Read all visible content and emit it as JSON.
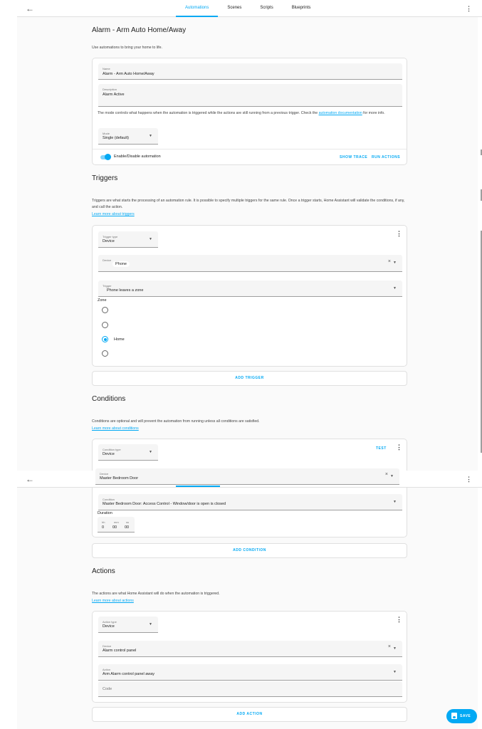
{
  "nav": {
    "tabs": [
      "Automations",
      "Scenes",
      "Scripts",
      "Blueprints"
    ],
    "active_tab": "Automations"
  },
  "page": {
    "title": "Alarm - Arm Auto Home/Away",
    "intro": "Use automations to bring your home to life."
  },
  "details": {
    "name_label": "Name",
    "name_value": "Alarm - Arm Auto Home/Away",
    "description_label": "Description",
    "description_value": "Alarm Active",
    "mode_text": "The mode controls what happens when the automation is triggered while the actions are still running from a previous trigger. Check the",
    "mode_link": "automation documentation",
    "mode_text_end": "for more info.",
    "mode_label": "Mode",
    "mode_value": "Single (default)",
    "toggle_label": "Enable/Disable automation",
    "show_trace": "SHOW TRACE",
    "run_actions": "RUN ACTIONS"
  },
  "triggers": {
    "heading": "Triggers",
    "description": "Triggers are what starts the processing of an automation rule. It is possible to specify multiple triggers for the same rule. Once a trigger starts, Home Assistant will validate the conditions, if any, and call the action.",
    "learn_more": "Learn more about triggers",
    "type_label": "Trigger type",
    "type_value": "Device",
    "device_label": "Device",
    "device_value": "Phone",
    "trigger_label": "Trigger",
    "trigger_value": "Phone leaves a zone",
    "zone_label": "Zone",
    "zone_options": [
      "",
      "",
      "Home",
      ""
    ],
    "zone_selected_index": 2,
    "add_button": "ADD TRIGGER"
  },
  "conditions": {
    "heading": "Conditions",
    "description": "Conditions are optional and will prevent the automation from running unless all conditions are satisfied.",
    "learn_more": "Learn more about conditions",
    "type_label": "Condition type",
    "type_value": "Device",
    "test_button": "TEST",
    "device_label": "Device",
    "device_value": "Master Bedroom Door",
    "condition_label": "Condition",
    "condition_value": "Master Bedroom Door: Access Control - Window/door is open is closed",
    "duration_label": "Duration",
    "duration_units": [
      "hh",
      "mm",
      "ss"
    ],
    "duration_values": [
      "0",
      "00",
      "00"
    ],
    "add_button": "ADD CONDITION"
  },
  "actions": {
    "heading": "Actions",
    "description": "The actions are what Home Assistant will do when the automation is triggered.",
    "learn_more": "Learn more about actions",
    "type_label": "Action type",
    "type_value": "Device",
    "device_label": "Device",
    "device_value": "Alarm control panel",
    "action_label": "Action",
    "action_value": "Arm Alarm control panel away",
    "code_placeholder": "Code",
    "add_button": "ADD ACTION"
  },
  "fab": {
    "label": "SAVE"
  },
  "icons": {
    "back": "arrow-left-icon",
    "menu": "dots-vertical-icon",
    "dropdown": "menu-down-icon",
    "clear": "close-icon",
    "save": "content-save-icon"
  },
  "colors": {
    "accent": "#03a9f4",
    "background": "#fafafa",
    "card": "#ffffff"
  }
}
